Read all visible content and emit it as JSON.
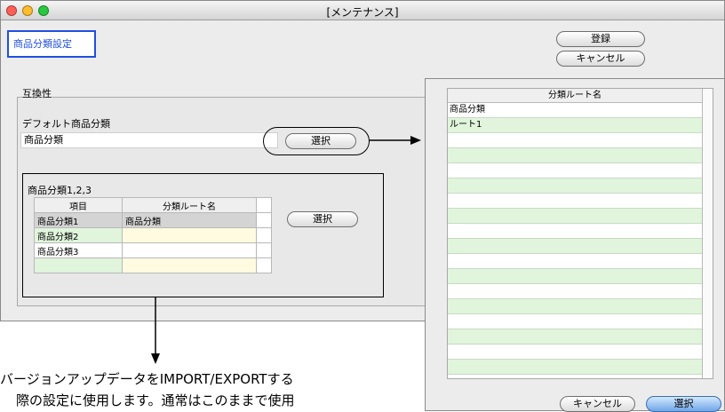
{
  "window": {
    "title": "[メンテナンス]"
  },
  "screen_label": "商品分類設定",
  "buttons": {
    "register": "登録",
    "cancel": "キャンセル"
  },
  "compat": {
    "section_title": "互換性",
    "default_label": "デフォルト商品分類",
    "default_value": "商品分類",
    "select_button": "選択"
  },
  "category_table": {
    "title": "商品分類1,2,3",
    "headers": [
      "項目",
      "分類ルート名"
    ],
    "rows": [
      [
        "商品分類1",
        "商品分類"
      ],
      [
        "商品分類2",
        ""
      ],
      [
        "商品分類3",
        ""
      ],
      [
        "",
        ""
      ]
    ],
    "select_button": "選択"
  },
  "route_list": {
    "header": "分類ルート名",
    "items": [
      "商品分類",
      "ルート1"
    ],
    "cancel_button": "キャンセル",
    "select_button": "選択"
  },
  "note": {
    "line1": "バージョンアップデータをIMPORT/EXPORTする",
    "line2": "際の設定に使用します。通常はこのままで使用"
  },
  "colors": {
    "accent": "#1f4fe0",
    "row_green": "#e0f5dc",
    "row_yellow": "#fffbe0"
  },
  "icons": [
    "close-light-icon",
    "minimize-light-icon",
    "zoom-light-icon",
    "arrow-right-icon",
    "arrow-down-icon"
  ]
}
